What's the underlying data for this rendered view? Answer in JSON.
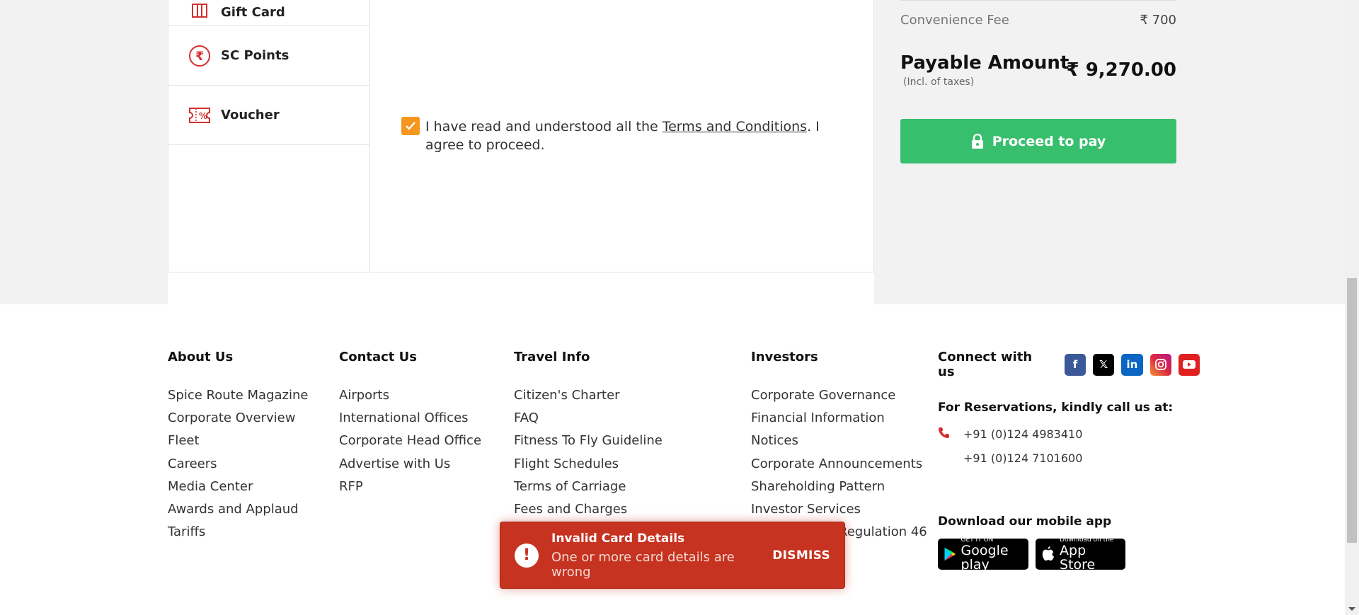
{
  "payment_methods": [
    {
      "label": "Gift Card",
      "icon": "gift-card-icon"
    },
    {
      "label": "SC Points",
      "icon": "rupee-icon"
    },
    {
      "label": "Voucher",
      "icon": "voucher-icon"
    }
  ],
  "terms": {
    "prefix": "I have read and understood all the ",
    "link": "Terms and Conditions",
    "suffix": ". I agree to proceed.",
    "checked": true
  },
  "summary": {
    "convenience_label": "Convenience Fee",
    "convenience_amount": "₹ 700",
    "payable_label": "Payable Amount",
    "payable_sub": "(Incl. of taxes)",
    "payable_amount": "₹ 9,270.00",
    "proceed_label": "Proceed to pay"
  },
  "footer": {
    "about": {
      "title": "About Us",
      "items": [
        "Spice Route Magazine",
        "Corporate Overview",
        "Fleet",
        "Careers",
        "Media Center",
        "Awards and Applaud",
        "Tariffs"
      ]
    },
    "contact": {
      "title": "Contact Us",
      "items": [
        "Airports",
        "International Offices",
        "Corporate Head Office",
        "Advertise with Us",
        "RFP"
      ]
    },
    "travel": {
      "title": "Travel Info",
      "items": [
        "Citizen's Charter",
        "FAQ",
        "Fitness To Fly Guideline",
        "Flight Schedules",
        "Terms of Carriage",
        "Fees and Charges"
      ]
    },
    "investors": {
      "title": "Investors",
      "items": [
        "Corporate Governance",
        "Financial Information",
        "Notices",
        "Corporate Announcements",
        "Shareholding Pattern",
        "Investor Services",
        "Regulation 46"
      ]
    },
    "connect": {
      "title": "Connect with us",
      "reservations_title": "For Reservations, kindly call us at:",
      "phone_1": "+91 (0)124 4983410",
      "phone_2": "+91 (0)124 7101600",
      "download_title": "Download our mobile app",
      "google_small": "GET IT ON",
      "google_big": "Google play",
      "apple_small": "Download on the",
      "apple_big": "App Store"
    }
  },
  "toast": {
    "title": "Invalid Card Details",
    "message": "One or more card details are wrong",
    "dismiss": "DISMISS"
  },
  "colors": {
    "accent_red": "#c63320",
    "proceed_green": "#38bf6e",
    "checkbox_orange": "#f5961e"
  }
}
